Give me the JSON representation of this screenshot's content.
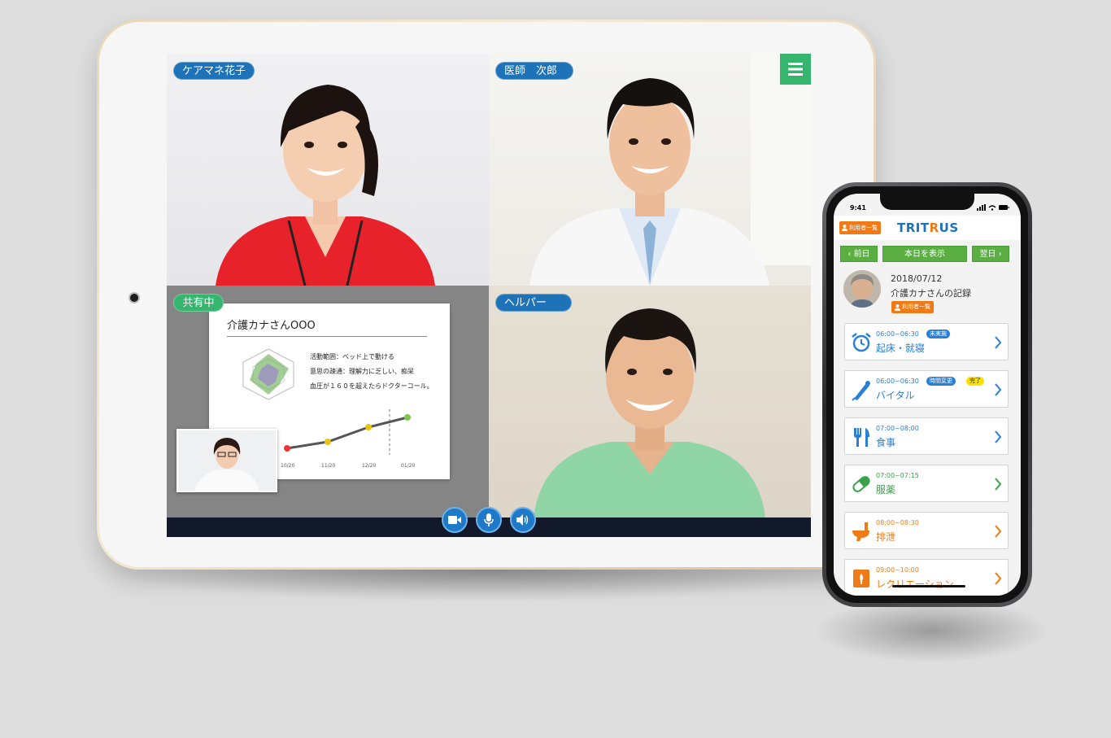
{
  "tablet": {
    "participants": [
      {
        "name": "ケアマネ花子"
      },
      {
        "name": "医師　次郎"
      },
      {
        "name": "ヘルパー"
      }
    ],
    "sharing_badge": "共有中",
    "slide": {
      "title": "介護カナさんOOO",
      "notes": [
        "活動範囲：ベッド上で動ける",
        "意思の疎通：理解力に乏しい、痴呆",
        "血圧が１６０を超えたらドクターコール。"
      ],
      "x_ticks": [
        "10/20",
        "11/20",
        "12/20",
        "01/20"
      ]
    },
    "controls": {
      "camera": "video-camera-icon",
      "mic": "microphone-icon",
      "speaker": "speaker-icon"
    },
    "menu_icon": "hamburger-icon",
    "colors": {
      "badge_blue": "#1e73b8",
      "badge_green": "#35b56e",
      "control_blue": "#1e79c8"
    }
  },
  "phone": {
    "status_time": "9:41",
    "header": {
      "user_list": "利用者一覧",
      "logo_a": "TRIT",
      "logo_b": "R",
      "logo_c": "US"
    },
    "date_nav": {
      "prev": "前日",
      "today": "本日を表示",
      "next": "翌日"
    },
    "record": {
      "date": "2018/07/12",
      "title": "介護カナさんの記録",
      "badge": "利用者一覧"
    },
    "tasks": [
      {
        "time": "06:00~06:30",
        "label": "起床・就寝",
        "icon": "alarm-clock-icon",
        "color": "#2a7fd4",
        "pills": [
          {
            "text": "未実施",
            "bg": "#2a7fd4",
            "fg": "#ffffff"
          }
        ]
      },
      {
        "time": "06:00~06:30",
        "label": "バイタル",
        "icon": "thermometer-icon",
        "color": "#2a7fd4",
        "pills": [
          {
            "text": "時間変更",
            "bg": "#2a7fd4",
            "fg": "#ffffff"
          },
          {
            "text": "完了",
            "bg": "#ffe100",
            "fg": "#333333"
          }
        ]
      },
      {
        "time": "07:00~08:00",
        "label": "食事",
        "icon": "fork-knife-icon",
        "color": "#2a7fd4",
        "pills": []
      },
      {
        "time": "07:00~07:15",
        "label": "服薬",
        "icon": "capsule-icon",
        "color": "#3aa24a",
        "pills": []
      },
      {
        "time": "08:00~08:30",
        "label": "排泄",
        "icon": "toilet-icon",
        "color": "#ee7a18",
        "pills": []
      },
      {
        "time": "09:00~10:00",
        "label": "レクリエーション",
        "icon": "recreation-icon",
        "color": "#ee7a18",
        "pills": []
      }
    ]
  }
}
